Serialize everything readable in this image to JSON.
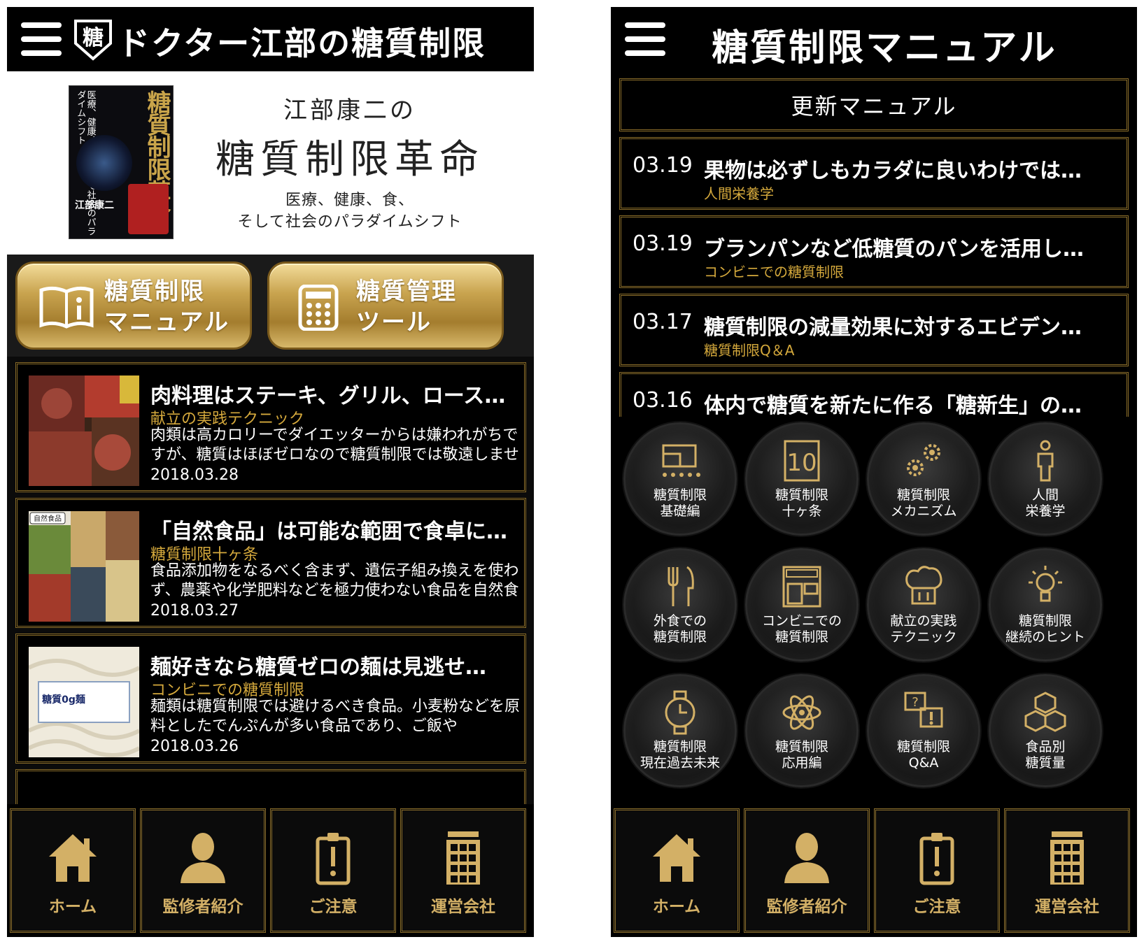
{
  "left": {
    "app_title": "ドクター江部の糖質制限",
    "banner": {
      "cover_title": "糖質制限革命",
      "cover_subtitle": "医療、健康、食、そして社会のパラダイムシフト",
      "cover_author": "江部康二",
      "line1": "江部康二の",
      "line2": "糖質制限革命",
      "line3a": "医療、健康、食、",
      "line3b": "そして社会のパラダイムシフト"
    },
    "buttons": [
      {
        "line1": "糖質制限",
        "line2": "マニュアル",
        "icon": "book-info-icon"
      },
      {
        "line1": "糖質管理",
        "line2": "ツール",
        "icon": "calculator-icon"
      }
    ],
    "articles": [
      {
        "title": "肉料理はステーキ、グリル、ロースト…",
        "category": "献立の実践テクニック",
        "description": "肉類は高カロリーでダイエッターからは嫌われがちですが、糖質はほぼゼロなので糖質制限では敬遠しませ",
        "date": "2018.03.28"
      },
      {
        "title": "「自然食品」は可能な範囲で食卓に…",
        "category": "糖質制限十ヶ条",
        "description": "食品添加物をなるべく含まず、遺伝子組み換えを使わず、農薬や化学肥料などを極力使わない食品を自然食",
        "date": "2018.03.27",
        "thumb_label": "自然食品"
      },
      {
        "title": "麺好きなら糖質ゼロの麺は見逃せ…",
        "category": "コンビニでの糖質制限",
        "description": "麺類は糖質制限では避けるべき食品。小麦粉などを原料としたでんぷんが多い食品であり、ご飯や",
        "date": "2018.03.26",
        "thumb_label": "糖質0g麺"
      }
    ]
  },
  "right": {
    "app_title": "糖質制限マニュアル",
    "update_header": "更新マニュアル",
    "updates": [
      {
        "date": "03.19",
        "title": "果物は必ずしもカラダに良いわけでは…",
        "category": "人間栄養学"
      },
      {
        "date": "03.19",
        "title": "ブランパンなど低糖質のパンを活用し…",
        "category": "コンビニでの糖質制限"
      },
      {
        "date": "03.17",
        "title": "糖質制限の減量効果に対するエビデン…",
        "category": "糖質制限Q＆A"
      },
      {
        "date": "03.16",
        "title": "体内で糖質を新たに作る「糖新生」の…",
        "category": ""
      }
    ],
    "categories": [
      {
        "label": "糖質制限\n基礎編",
        "icon": "blocks-foundation-icon"
      },
      {
        "label": "糖質制限\n十ヶ条",
        "icon": "number-ten-icon"
      },
      {
        "label": "糖質制限\nメカニズム",
        "icon": "gears-icon"
      },
      {
        "label": "人間\n栄養学",
        "icon": "person-icon"
      },
      {
        "label": "外食での\n糖質制限",
        "icon": "fork-knife-icon"
      },
      {
        "label": "コンビニでの\n糖質制限",
        "icon": "store-icon"
      },
      {
        "label": "献立の実践\nテクニック",
        "icon": "chef-hat-icon"
      },
      {
        "label": "糖質制限\n継続のヒント",
        "icon": "lightbulb-icon"
      },
      {
        "label": "糖質制限\n現在過去未来",
        "icon": "watch-icon"
      },
      {
        "label": "糖質制限\n応用編",
        "icon": "atom-icon"
      },
      {
        "label": "糖質制限\nQ&A",
        "icon": "question-answer-icon"
      },
      {
        "label": "食品別\n糖質量",
        "icon": "cubes-icon"
      }
    ]
  },
  "nav": [
    {
      "label": "ホーム",
      "icon": "home-icon"
    },
    {
      "label": "監修者紹介",
      "icon": "person-silhouette-icon"
    },
    {
      "label": "ご注意",
      "icon": "notice-badge-icon"
    },
    {
      "label": "運営会社",
      "icon": "building-icon"
    }
  ],
  "colors": {
    "gold": "#d5a93c",
    "gold_dark": "#8a6d2a",
    "background": "#000000"
  }
}
